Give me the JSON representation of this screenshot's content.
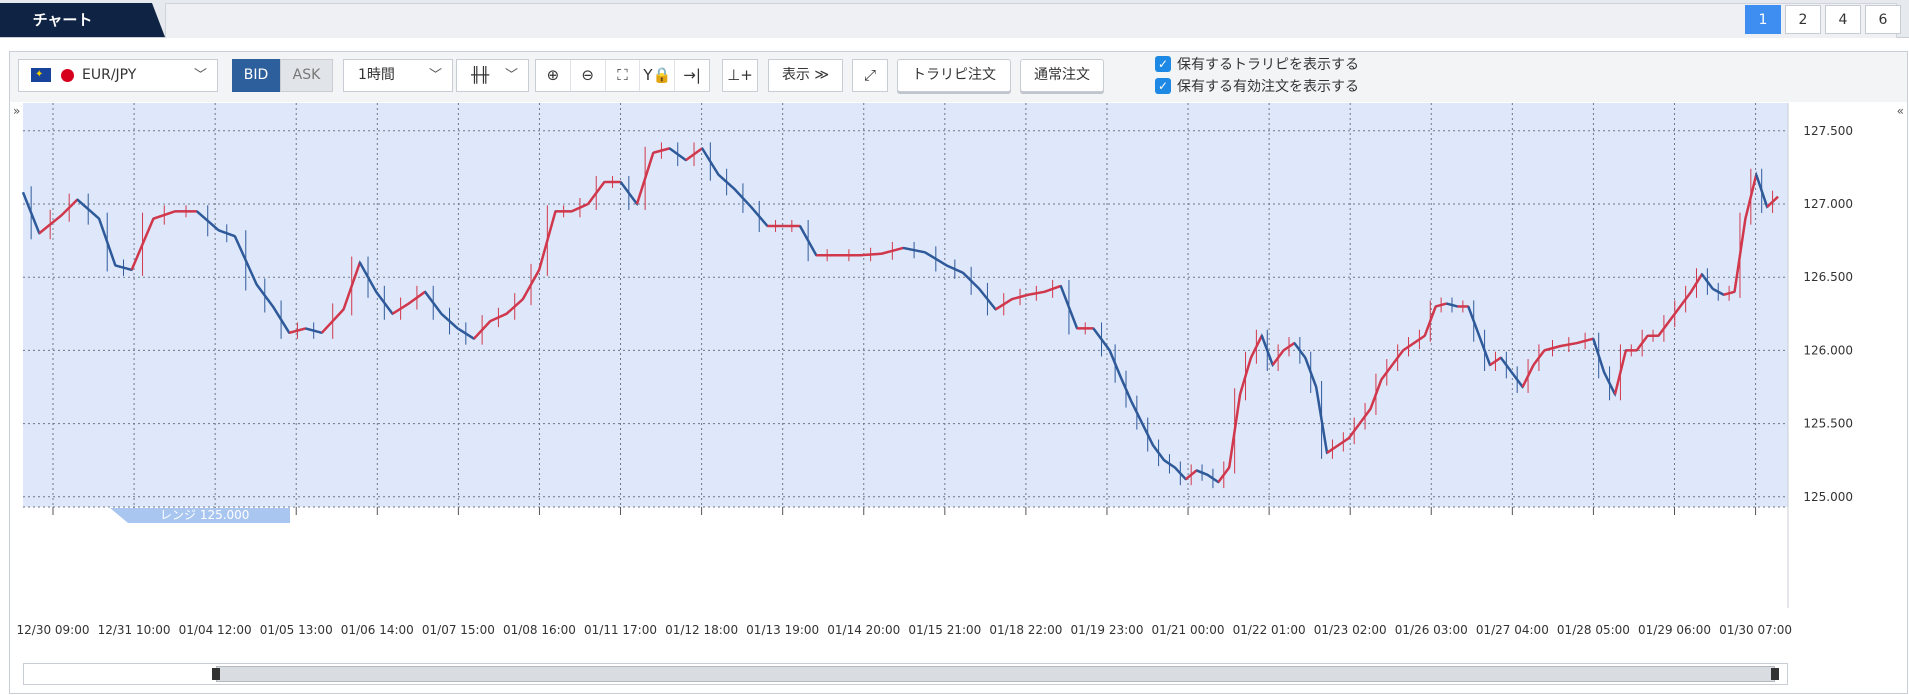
{
  "tabs": {
    "chart_label": "チャート",
    "pages": [
      "1",
      "2",
      "4",
      "6"
    ],
    "active_page": "1"
  },
  "toolbar": {
    "pair": "EUR/JPY",
    "bid": "BID",
    "ask": "ASK",
    "interval": "1時間",
    "display": "表示",
    "trail_order": "トラリピ注文",
    "normal_order": "通常注文",
    "check1": "保有するトラリピを表示する",
    "check2": "保有する有効注文を表示する"
  },
  "range_label": "レンジ 125.000",
  "colors": {
    "up": "#d2384c",
    "down": "#2f5a9a",
    "plot_bg": "#dfe8fb"
  },
  "chart_data": {
    "type": "candlestick-line",
    "pair": "EUR/JPY",
    "y_ticks": [
      "125.000",
      "125.500",
      "126.000",
      "126.500",
      "127.000",
      "127.500"
    ],
    "ylim": [
      124.93,
      127.69
    ],
    "x_ticks": [
      "12/30 09:00",
      "12/31 10:00",
      "01/04 12:00",
      "01/05 13:00",
      "01/06 14:00",
      "01/07 15:00",
      "01/08 16:00",
      "01/11 17:00",
      "01/12 18:00",
      "01/13 19:00",
      "01/14 20:00",
      "01/15 21:00",
      "01/18 22:00",
      "01/19 23:00",
      "01/21 00:00",
      "01/22 01:00",
      "01/23 02:00",
      "01/26 03:00",
      "01/27 04:00",
      "01/28 05:00",
      "01/29 06:00",
      "01/30 07:00"
    ],
    "price_points": [
      [
        0,
        127.08
      ],
      [
        6,
        126.8
      ],
      [
        14,
        126.92
      ],
      [
        20,
        127.03
      ],
      [
        28,
        126.9
      ],
      [
        34,
        126.58
      ],
      [
        40,
        126.55
      ],
      [
        48,
        126.9
      ],
      [
        56,
        126.95
      ],
      [
        64,
        126.95
      ],
      [
        72,
        126.82
      ],
      [
        78,
        126.78
      ],
      [
        86,
        126.45
      ],
      [
        92,
        126.3
      ],
      [
        98,
        126.12
      ],
      [
        104,
        126.15
      ],
      [
        110,
        126.12
      ],
      [
        118,
        126.28
      ],
      [
        124,
        126.6
      ],
      [
        130,
        126.4
      ],
      [
        136,
        126.25
      ],
      [
        142,
        126.32
      ],
      [
        148,
        126.4
      ],
      [
        154,
        126.25
      ],
      [
        160,
        126.15
      ],
      [
        166,
        126.08
      ],
      [
        172,
        126.2
      ],
      [
        178,
        126.25
      ],
      [
        184,
        126.35
      ],
      [
        190,
        126.55
      ],
      [
        196,
        126.95
      ],
      [
        202,
        126.95
      ],
      [
        208,
        127.0
      ],
      [
        214,
        127.15
      ],
      [
        220,
        127.15
      ],
      [
        226,
        127.0
      ],
      [
        232,
        127.35
      ],
      [
        238,
        127.38
      ],
      [
        244,
        127.3
      ],
      [
        250,
        127.38
      ],
      [
        256,
        127.2
      ],
      [
        262,
        127.1
      ],
      [
        268,
        126.98
      ],
      [
        274,
        126.85
      ],
      [
        280,
        126.85
      ],
      [
        286,
        126.85
      ],
      [
        292,
        126.65
      ],
      [
        300,
        126.65
      ],
      [
        308,
        126.65
      ],
      [
        316,
        126.66
      ],
      [
        324,
        126.7
      ],
      [
        332,
        126.67
      ],
      [
        340,
        126.58
      ],
      [
        346,
        126.53
      ],
      [
        352,
        126.42
      ],
      [
        358,
        126.28
      ],
      [
        364,
        126.35
      ],
      [
        370,
        126.38
      ],
      [
        376,
        126.4
      ],
      [
        382,
        126.44
      ],
      [
        388,
        126.15
      ],
      [
        394,
        126.15
      ],
      [
        400,
        126.0
      ],
      [
        404,
        125.82
      ],
      [
        408,
        125.65
      ],
      [
        412,
        125.5
      ],
      [
        416,
        125.35
      ],
      [
        420,
        125.25
      ],
      [
        424,
        125.2
      ],
      [
        428,
        125.12
      ],
      [
        432,
        125.18
      ],
      [
        436,
        125.15
      ],
      [
        440,
        125.1
      ],
      [
        444,
        125.2
      ],
      [
        448,
        125.7
      ],
      [
        452,
        125.95
      ],
      [
        456,
        126.1
      ],
      [
        460,
        125.9
      ],
      [
        464,
        126.0
      ],
      [
        468,
        126.05
      ],
      [
        472,
        125.95
      ],
      [
        476,
        125.75
      ],
      [
        480,
        125.3
      ],
      [
        484,
        125.35
      ],
      [
        488,
        125.4
      ],
      [
        492,
        125.5
      ],
      [
        496,
        125.6
      ],
      [
        500,
        125.8
      ],
      [
        504,
        125.9
      ],
      [
        508,
        126.0
      ],
      [
        512,
        126.05
      ],
      [
        516,
        126.1
      ],
      [
        520,
        126.3
      ],
      [
        524,
        126.32
      ],
      [
        528,
        126.3
      ],
      [
        532,
        126.3
      ],
      [
        536,
        126.1
      ],
      [
        540,
        125.9
      ],
      [
        544,
        125.95
      ],
      [
        548,
        125.85
      ],
      [
        552,
        125.75
      ],
      [
        556,
        125.9
      ],
      [
        560,
        126.0
      ],
      [
        566,
        126.03
      ],
      [
        572,
        126.05
      ],
      [
        578,
        126.08
      ],
      [
        582,
        125.85
      ],
      [
        586,
        125.7
      ],
      [
        590,
        126.0
      ],
      [
        594,
        126.0
      ],
      [
        598,
        126.1
      ],
      [
        602,
        126.1
      ],
      [
        606,
        126.2
      ],
      [
        610,
        126.3
      ],
      [
        614,
        126.4
      ],
      [
        618,
        126.52
      ],
      [
        622,
        126.42
      ],
      [
        626,
        126.38
      ],
      [
        630,
        126.4
      ],
      [
        634,
        126.9
      ],
      [
        638,
        127.2
      ],
      [
        642,
        126.98
      ],
      [
        646,
        127.05
      ]
    ]
  }
}
